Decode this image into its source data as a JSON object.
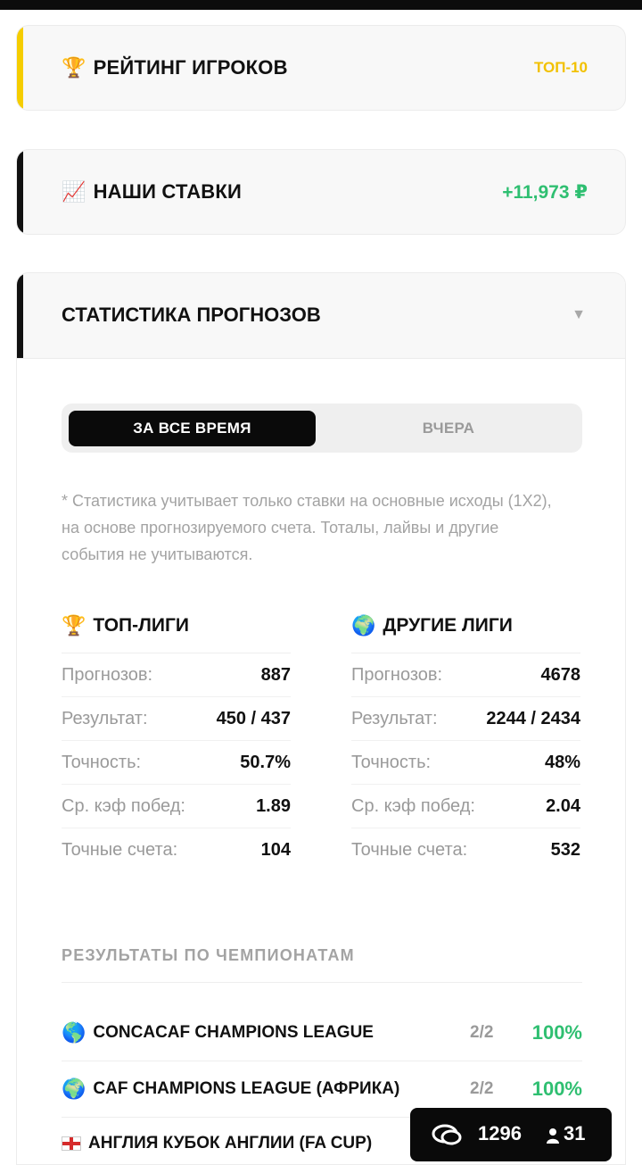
{
  "rating_card": {
    "emoji": "🏆",
    "title": "РЕЙТИНГ ИГРОКОВ",
    "badge": "ТОП-10",
    "accent_color": "#f5cd00"
  },
  "bets_card": {
    "emoji": "📈",
    "title": "НАШИ СТАВКИ",
    "value": "+11,973 ₽",
    "accent_color": "#111111",
    "value_color": "#2fbf71"
  },
  "stats": {
    "title": "СТАТИСТИКА ПРОГНОЗОВ",
    "chevron": "▼",
    "tabs": [
      "ЗА ВСЕ ВРЕМЯ",
      "ВЧЕРА"
    ],
    "active_tab": "ЗА ВСЕ ВРЕМЯ",
    "note": "* Статистика учитывает только ставки на основные исходы (1X2), на основе прогнозируемого счета. Тоталы, лайвы и другие события не учитываются.",
    "top_leagues": {
      "emoji": "🏆",
      "title": "ТОП-ЛИГИ",
      "rows": [
        {
          "label": "Прогнозов:",
          "value": "887"
        },
        {
          "label": "Результат:",
          "value": "450 / 437"
        },
        {
          "label": "Точность:",
          "value": "50.7%"
        },
        {
          "label": "Ср. кэф побед:",
          "value": "1.89"
        },
        {
          "label": "Точные счета:",
          "value": "104"
        }
      ]
    },
    "other_leagues": {
      "emoji": "🌍",
      "title": "ДРУГИЕ ЛИГИ",
      "rows": [
        {
          "label": "Прогнозов:",
          "value": "4678"
        },
        {
          "label": "Результат:",
          "value": "2244 / 2434"
        },
        {
          "label": "Точность:",
          "value": "48%"
        },
        {
          "label": "Ср. кэф побед:",
          "value": "2.04"
        },
        {
          "label": "Точные счета:",
          "value": "532"
        }
      ]
    },
    "by_championship_title": "РЕЗУЛЬТАТЫ ПО ЧЕМПИОНАТАМ",
    "championships": [
      {
        "icon": "🌎",
        "name": "CONCACAF CHAMPIONS LEAGUE",
        "score": "2/2",
        "percent": "100%"
      },
      {
        "icon": "🌍",
        "name": "CAF CHAMPIONS LEAGUE (АФРИКА)",
        "score": "2/2",
        "percent": "100%"
      },
      {
        "icon": "england-flag",
        "name": "АНГЛИЯ КУБОК АНГЛИИ (FA CUP)",
        "score": "",
        "percent": ""
      }
    ]
  },
  "chat_widget": {
    "messages": "1296",
    "users": "31",
    "icons": [
      "chat-bubbles-icon",
      "user-icon"
    ]
  }
}
